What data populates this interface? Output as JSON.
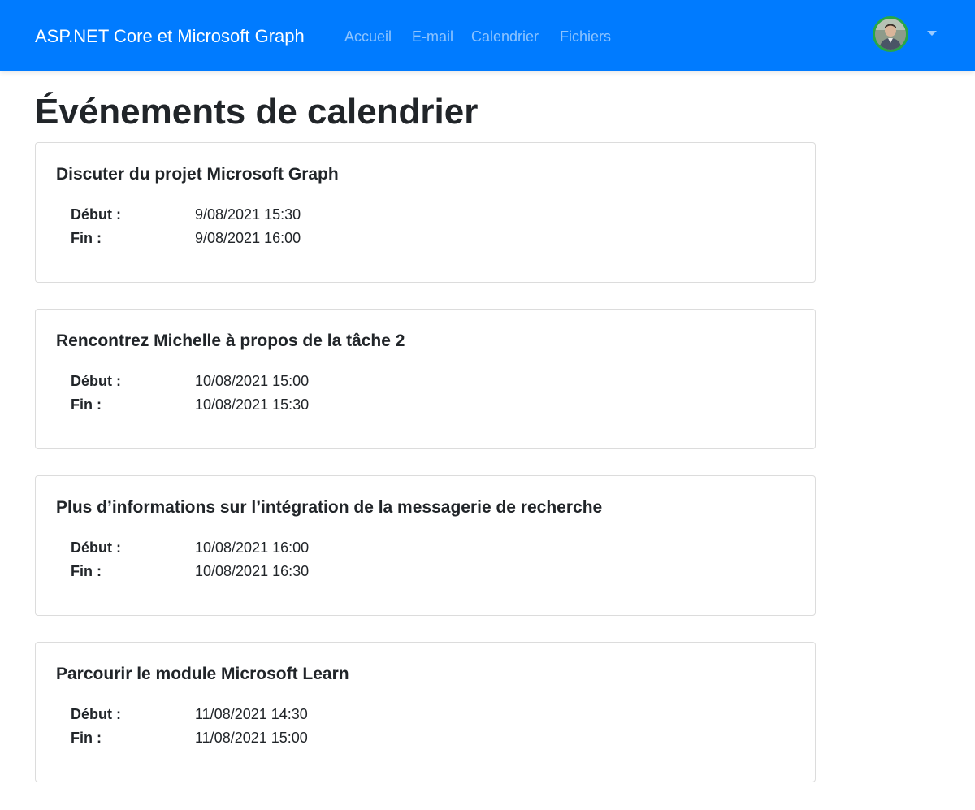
{
  "navbar": {
    "brand": "ASP.NET Core et Microsoft Graph",
    "links": [
      "Accueil",
      "E-mail",
      "Calendrier",
      "Fichiers"
    ],
    "avatar_border_color": "#28a745",
    "bg_color": "#007bff"
  },
  "page": {
    "title": "Événements de calendrier"
  },
  "events": [
    {
      "subject": "Discuter du projet Microsoft Graph",
      "start_label": "Début :",
      "start": "9/08/2021 15:30",
      "end_label": "Fin :",
      "end": "9/08/2021 16:00"
    },
    {
      "subject": "Rencontrez Michelle à propos de la tâche 2",
      "start_label": "Début :",
      "start": "10/08/2021 15:00",
      "end_label": "Fin :",
      "end": "10/08/2021 15:30"
    },
    {
      "subject": "Plus d’informations sur l’intégration de la messagerie de recherche",
      "start_label": "Début :",
      "start": "10/08/2021 16:00",
      "end_label": "Fin :",
      "end": "10/08/2021 16:30"
    },
    {
      "subject": "Parcourir le module Microsoft Learn",
      "start_label": "Début :",
      "start": "11/08/2021 14:30",
      "end_label": "Fin :",
      "end": "11/08/2021 15:00"
    }
  ]
}
